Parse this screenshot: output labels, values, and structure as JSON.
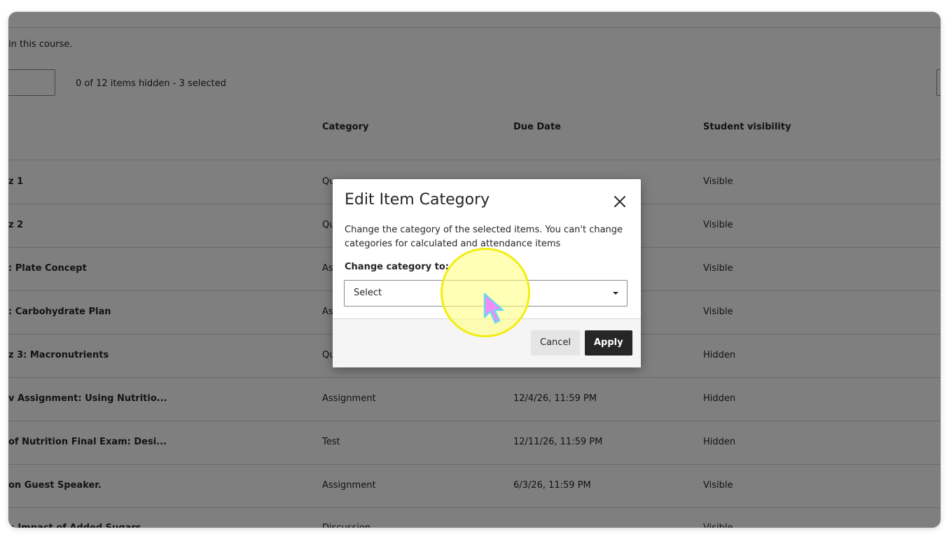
{
  "page": {
    "intro_text": "in this course.",
    "items_status": "0 of 12 items hidden - 3 selected",
    "columns": {
      "category": "Category",
      "due_date": "Due Date",
      "visibility": "Student visibility"
    },
    "rows": [
      {
        "name": "z 1",
        "category": "Qu",
        "due": "",
        "visibility": "Visible"
      },
      {
        "name": "z 2",
        "category": "Qu",
        "due": "",
        "visibility": "Visible"
      },
      {
        "name": ": Plate Concept",
        "category": "As",
        "due": "",
        "visibility": "Visible"
      },
      {
        "name": ": Carbohydrate Plan",
        "category": "As",
        "due": "",
        "visibility": "Visible"
      },
      {
        "name": "z 3: Macronutrients",
        "category": "Qu",
        "due": "",
        "visibility": "Hidden"
      },
      {
        "name": "v Assignment: Using Nutritio...",
        "category": "Assignment",
        "due": "12/4/26, 11:59 PM",
        "visibility": "Hidden"
      },
      {
        "name": "of Nutrition Final Exam: Desi...",
        "category": "Test",
        "due": "12/11/26, 11:59 PM",
        "visibility": "Hidden"
      },
      {
        "name": "on Guest Speaker.",
        "category": "Assignment",
        "due": "6/3/26, 11:59 PM",
        "visibility": "Visible"
      },
      {
        "name": "e Impact of Added Sugars",
        "category": "Discussion",
        "due": "—",
        "visibility": "Visible"
      }
    ]
  },
  "modal": {
    "title": "Edit Item Category",
    "description": "Change the category of the selected items. You can't change categories for calculated and attendance items",
    "field_label": "Change category to:",
    "select_value": "Select",
    "cancel_label": "Cancel",
    "apply_label": "Apply"
  },
  "icons": {
    "close": "close-icon",
    "dropdown": "chevron-down-icon",
    "cursor": "mouse-pointer-icon"
  },
  "colors": {
    "overlay": "#7f7f7f",
    "primary_button": "#262626",
    "highlight": "#f2ee10",
    "cursor": "#f08cf5"
  }
}
